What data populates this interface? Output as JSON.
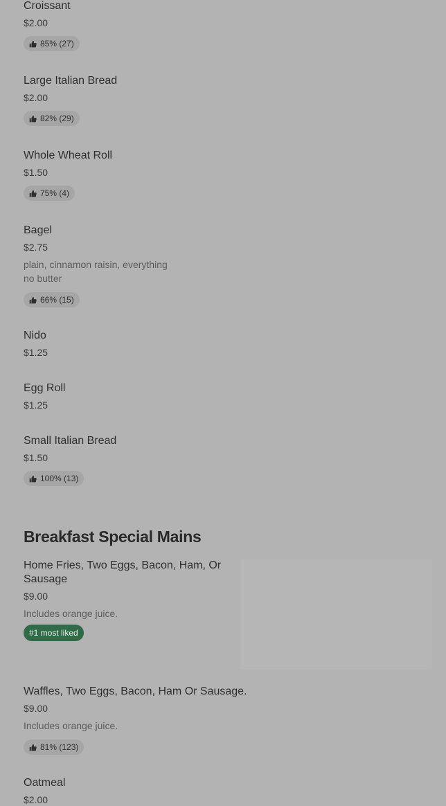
{
  "items": [
    {
      "name": "Croissant",
      "price": "$2.00",
      "rating": "85% (27)"
    },
    {
      "name": "Large Italian Bread",
      "price": "$2.00",
      "rating": "82% (29)"
    },
    {
      "name": "Whole Wheat Roll",
      "price": "$1.50",
      "rating": "75% (4)"
    },
    {
      "name": "Bagel",
      "price": "$2.75",
      "desc1": "plain, cinnamon raisin, everything",
      "desc2": "no butter",
      "rating": "66% (15)"
    },
    {
      "name": "Nido",
      "price": "$1.25"
    },
    {
      "name": "Egg Roll",
      "price": "$1.25"
    },
    {
      "name": "Small Italian Bread",
      "price": "$1.50",
      "rating": "100% (13)"
    }
  ],
  "section": {
    "title": "Breakfast Special Mains"
  },
  "mains": [
    {
      "name_line1": "Home Fries, Two Eggs, Bacon, Ham, Or",
      "name_line2": "Sausage",
      "price": "$9.00",
      "desc": "Includes orange juice.",
      "badge": "#1 most liked"
    },
    {
      "name": "Waffles, Two Eggs, Bacon, Ham Or Sausage.",
      "price": "$9.00",
      "desc": "Includes orange juice.",
      "rating": "81% (123)"
    },
    {
      "name": "Oatmeal",
      "price": "$2.00"
    }
  ],
  "colors": {
    "background": "#b3b3b3",
    "pill": "#a6a6a6",
    "badge": "#2f6b47"
  },
  "icons": {
    "rating": "thumbs-up-icon"
  }
}
